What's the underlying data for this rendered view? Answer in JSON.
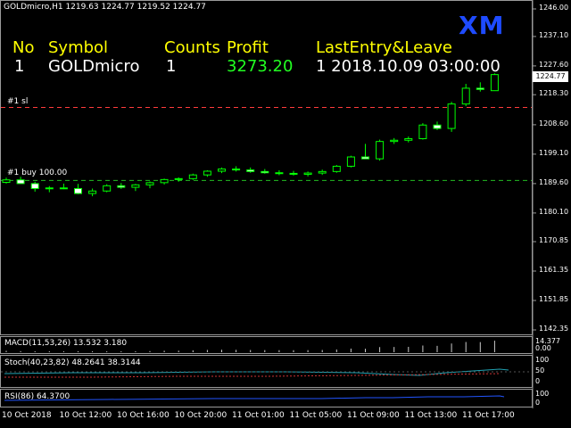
{
  "window": {
    "title": "GOLDmicro,H1  1219.63 1224.77 1219.52 1224.77",
    "brand": "XM"
  },
  "table": {
    "headers": [
      "No",
      "Symbol",
      "Counts",
      "Profit",
      "LastEntry&Leave"
    ],
    "row": [
      "1",
      "GOLDmicro",
      "1",
      "3273.20",
      "1 2018.10.09 03:00:00"
    ]
  },
  "lines": {
    "sl_label": "#1 sl",
    "buy_label": "#1 buy 100.00",
    "sl_price": 1214.2,
    "buy_price": 1190.6
  },
  "price_axis": {
    "ticks": [
      "1246.00",
      "1237.10",
      "1227.60",
      "1218.30",
      "1208.60",
      "1199.10",
      "1189.60",
      "1180.10",
      "1170.85",
      "1161.35",
      "1151.85",
      "1142.35"
    ],
    "current": "1224.77"
  },
  "time_axis": {
    "ticks": [
      "10 Oct 2018",
      "10 Oct 12:00",
      "10 Oct 16:00",
      "10 Oct 20:00",
      "11 Oct 01:00",
      "11 Oct 05:00",
      "11 Oct 09:00",
      "11 Oct 13:00",
      "11 Oct 17:00"
    ]
  },
  "indicators": {
    "macd": {
      "label": "MACD(11,53,26) 13.532 3.180",
      "top_value": "14.377",
      "zero_value": "0.00"
    },
    "stoch": {
      "label": "Stoch(40,23,82) 48.2641 38.3144",
      "levels": [
        "100",
        "50",
        "0"
      ]
    },
    "rsi": {
      "label": "RSI(86) 64.3700",
      "levels": [
        "100",
        "0"
      ]
    }
  },
  "colors": {
    "bull": "#00ff00",
    "bear_body": "#ffffff",
    "sl_line": "#ff3b3b",
    "buy_line": "#22bb22",
    "header_text": "#ffff00",
    "profit_text": "#22ff22",
    "brand": "#1e4bff"
  },
  "chart_data": {
    "type": "candlestick",
    "series": [
      {
        "o": 1190.0,
        "h": 1191.5,
        "l": 1189.6,
        "c": 1190.8
      },
      {
        "o": 1190.8,
        "h": 1191.8,
        "l": 1189.9,
        "c": 1189.6
      },
      {
        "o": 1189.6,
        "h": 1190.2,
        "l": 1187.0,
        "c": 1188.0
      },
      {
        "o": 1188.0,
        "h": 1188.8,
        "l": 1186.8,
        "c": 1188.2
      },
      {
        "o": 1188.2,
        "h": 1189.6,
        "l": 1187.8,
        "c": 1188.0
      },
      {
        "o": 1188.0,
        "h": 1189.5,
        "l": 1186.2,
        "c": 1186.4
      },
      {
        "o": 1186.4,
        "h": 1188.0,
        "l": 1185.5,
        "c": 1187.2
      },
      {
        "o": 1187.2,
        "h": 1189.4,
        "l": 1186.8,
        "c": 1188.9
      },
      {
        "o": 1188.9,
        "h": 1189.8,
        "l": 1187.9,
        "c": 1188.4
      },
      {
        "o": 1188.4,
        "h": 1189.5,
        "l": 1187.2,
        "c": 1189.2
      },
      {
        "o": 1189.2,
        "h": 1190.3,
        "l": 1188.1,
        "c": 1189.9
      },
      {
        "o": 1189.9,
        "h": 1191.2,
        "l": 1189.3,
        "c": 1190.9
      },
      {
        "o": 1190.9,
        "h": 1191.6,
        "l": 1190.2,
        "c": 1191.2
      },
      {
        "o": 1191.2,
        "h": 1192.8,
        "l": 1190.8,
        "c": 1192.4
      },
      {
        "o": 1192.4,
        "h": 1193.9,
        "l": 1191.8,
        "c": 1193.6
      },
      {
        "o": 1193.6,
        "h": 1194.8,
        "l": 1193.0,
        "c": 1194.3
      },
      {
        "o": 1194.3,
        "h": 1195.2,
        "l": 1193.5,
        "c": 1194.0
      },
      {
        "o": 1194.0,
        "h": 1194.8,
        "l": 1193.1,
        "c": 1193.5
      },
      {
        "o": 1193.5,
        "h": 1194.3,
        "l": 1192.8,
        "c": 1193.1
      },
      {
        "o": 1193.1,
        "h": 1193.9,
        "l": 1192.3,
        "c": 1192.9
      },
      {
        "o": 1192.9,
        "h": 1193.7,
        "l": 1192.2,
        "c": 1192.6
      },
      {
        "o": 1192.6,
        "h": 1193.5,
        "l": 1191.9,
        "c": 1193.0
      },
      {
        "o": 1193.0,
        "h": 1194.1,
        "l": 1192.4,
        "c": 1193.5
      },
      {
        "o": 1193.5,
        "h": 1195.6,
        "l": 1193.1,
        "c": 1195.2
      },
      {
        "o": 1195.2,
        "h": 1198.6,
        "l": 1194.8,
        "c": 1198.2
      },
      {
        "o": 1198.2,
        "h": 1202.4,
        "l": 1197.5,
        "c": 1197.6
      },
      {
        "o": 1197.6,
        "h": 1203.8,
        "l": 1197.0,
        "c": 1203.2
      },
      {
        "o": 1203.2,
        "h": 1204.3,
        "l": 1202.4,
        "c": 1203.6
      },
      {
        "o": 1203.6,
        "h": 1204.8,
        "l": 1202.9,
        "c": 1204.1
      },
      {
        "o": 1204.1,
        "h": 1209.1,
        "l": 1203.8,
        "c": 1208.5
      },
      {
        "o": 1208.5,
        "h": 1209.6,
        "l": 1206.9,
        "c": 1207.4
      },
      {
        "o": 1207.4,
        "h": 1216.0,
        "l": 1206.3,
        "c": 1215.3
      },
      {
        "o": 1215.3,
        "h": 1221.8,
        "l": 1214.6,
        "c": 1220.4
      },
      {
        "o": 1220.4,
        "h": 1222.3,
        "l": 1219.3,
        "c": 1220.0
      },
      {
        "o": 1219.6,
        "h": 1225.2,
        "l": 1219.5,
        "c": 1224.8
      }
    ],
    "ylim": [
      1142.35,
      1246.0
    ]
  }
}
